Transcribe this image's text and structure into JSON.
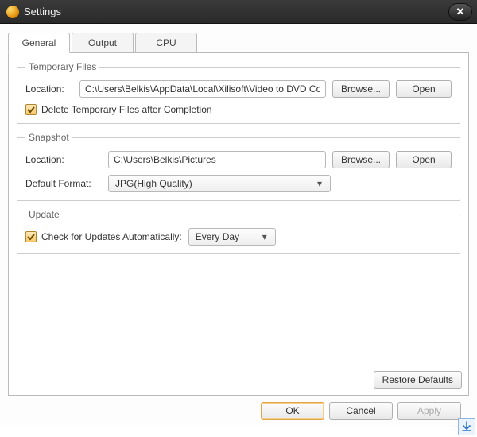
{
  "window": {
    "title": "Settings"
  },
  "tabs": [
    {
      "label": "General"
    },
    {
      "label": "Output"
    },
    {
      "label": "CPU"
    }
  ],
  "temp": {
    "legend": "Temporary Files",
    "location_label": "Location:",
    "location_value": "C:\\Users\\Belkis\\AppData\\Local\\Xilisoft\\Video to DVD Co",
    "browse": "Browse...",
    "open": "Open",
    "delete_label": "Delete Temporary Files after Completion"
  },
  "snapshot": {
    "legend": "Snapshot",
    "location_label": "Location:",
    "location_value": "C:\\Users\\Belkis\\Pictures",
    "browse": "Browse...",
    "open": "Open",
    "format_label": "Default Format:",
    "format_value": "JPG(High Quality)"
  },
  "update": {
    "legend": "Update",
    "check_label": "Check for Updates Automatically:",
    "interval": "Every Day"
  },
  "buttons": {
    "restore": "Restore Defaults",
    "ok": "OK",
    "cancel": "Cancel",
    "apply": "Apply"
  }
}
